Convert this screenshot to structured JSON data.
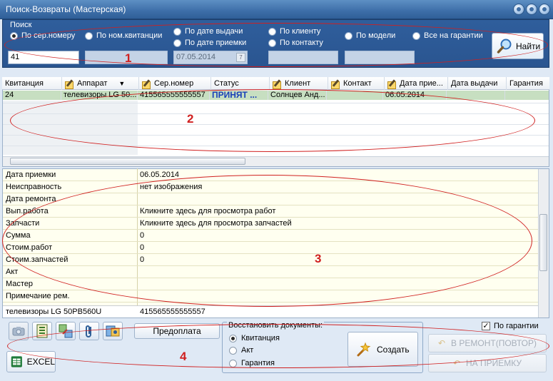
{
  "window": {
    "title": "Поиск-Возвраты (Мастерская)"
  },
  "search": {
    "legend": "Поиск",
    "options": [
      {
        "label": "По сер.номеру",
        "selected": true
      },
      {
        "label": "По ном.квитанции",
        "selected": false
      },
      {
        "label": "По дате выдачи",
        "selected": false
      },
      {
        "label": "По дате приемки",
        "selected": false
      },
      {
        "label": "По клиенту",
        "selected": false
      },
      {
        "label": "По контакту",
        "selected": false
      },
      {
        "label": "По модели",
        "selected": false
      },
      {
        "label": "Все на гарантии",
        "selected": false
      }
    ],
    "value": "41",
    "date_value": "07.05.2014",
    "find_label": "Найти"
  },
  "annotations": {
    "n1": "1",
    "n2": "2",
    "n3": "3",
    "n4": "4"
  },
  "grid": {
    "headers": [
      "Квитанция",
      "Аппарат",
      "Сер.номер",
      "Статус",
      "Клиент",
      "Контакт",
      "Дата прие...",
      "Дата выдачи",
      "Гарантия"
    ],
    "rows": [
      {
        "receipt": "24",
        "device": "телевизоры LG 50...",
        "serial": "415565555555557",
        "status": "ПРИНЯТ ...",
        "client": "Солнцев Анд...",
        "contact": "",
        "received": "06.05.2014",
        "issued": "",
        "warranty": ""
      }
    ]
  },
  "details": {
    "rows": [
      {
        "label": "Дата приемки",
        "value": "06.05.2014"
      },
      {
        "label": "Неисправность",
        "value": "нет изображения"
      },
      {
        "label": "Дата ремонта",
        "value": ""
      },
      {
        "label": "Вып.работа",
        "value": "Кликните здесь для просмотра работ"
      },
      {
        "label": "Запчасти",
        "value": "Кликните здесь для просмотра запчастей"
      },
      {
        "label": "Сумма",
        "value": "0"
      },
      {
        "label": "Стоим.работ",
        "value": "0"
      },
      {
        "label": "Стоим.запчастей",
        "value": "0"
      },
      {
        "label": "Акт",
        "value": ""
      },
      {
        "label": "Мастер",
        "value": ""
      },
      {
        "label": "Примечание рем.",
        "value": ""
      }
    ],
    "footer": {
      "device": "телевизоры LG 50PB560U",
      "serial": "415565555555557"
    }
  },
  "toolbar": {
    "prepay_label": "Предоплата",
    "excel_label": "EXCEL",
    "restore_legend": "Восстановить документы:",
    "restore_options": [
      {
        "label": "Квитанция",
        "selected": true
      },
      {
        "label": "Акт",
        "selected": false
      },
      {
        "label": "Гарантия",
        "selected": false
      }
    ],
    "create_label": "Создать",
    "warranty_check_label": "По гарантии",
    "warranty_checked": true,
    "to_repair_label": "В РЕМОНТ(ПОВТОР)",
    "to_intake_label": "НА ПРИЕМКУ"
  },
  "colors": {
    "title_bar": "#3d6ea8",
    "search_panel": "#2a5590",
    "selected_row": "#c7dfc1",
    "details_bg": "#fffff0",
    "status_text": "#1a3fb8",
    "annotation": "#d02020"
  },
  "icons": [
    "minimize-icon",
    "maximize-icon",
    "close-icon",
    "magnifier-icon",
    "calendar-icon",
    "edit-icon",
    "sort-down-icon",
    "camera-icon",
    "document-icon",
    "transfer-icon",
    "clip-icon",
    "image-icon",
    "excel-icon",
    "wand-icon",
    "return-icon"
  ]
}
